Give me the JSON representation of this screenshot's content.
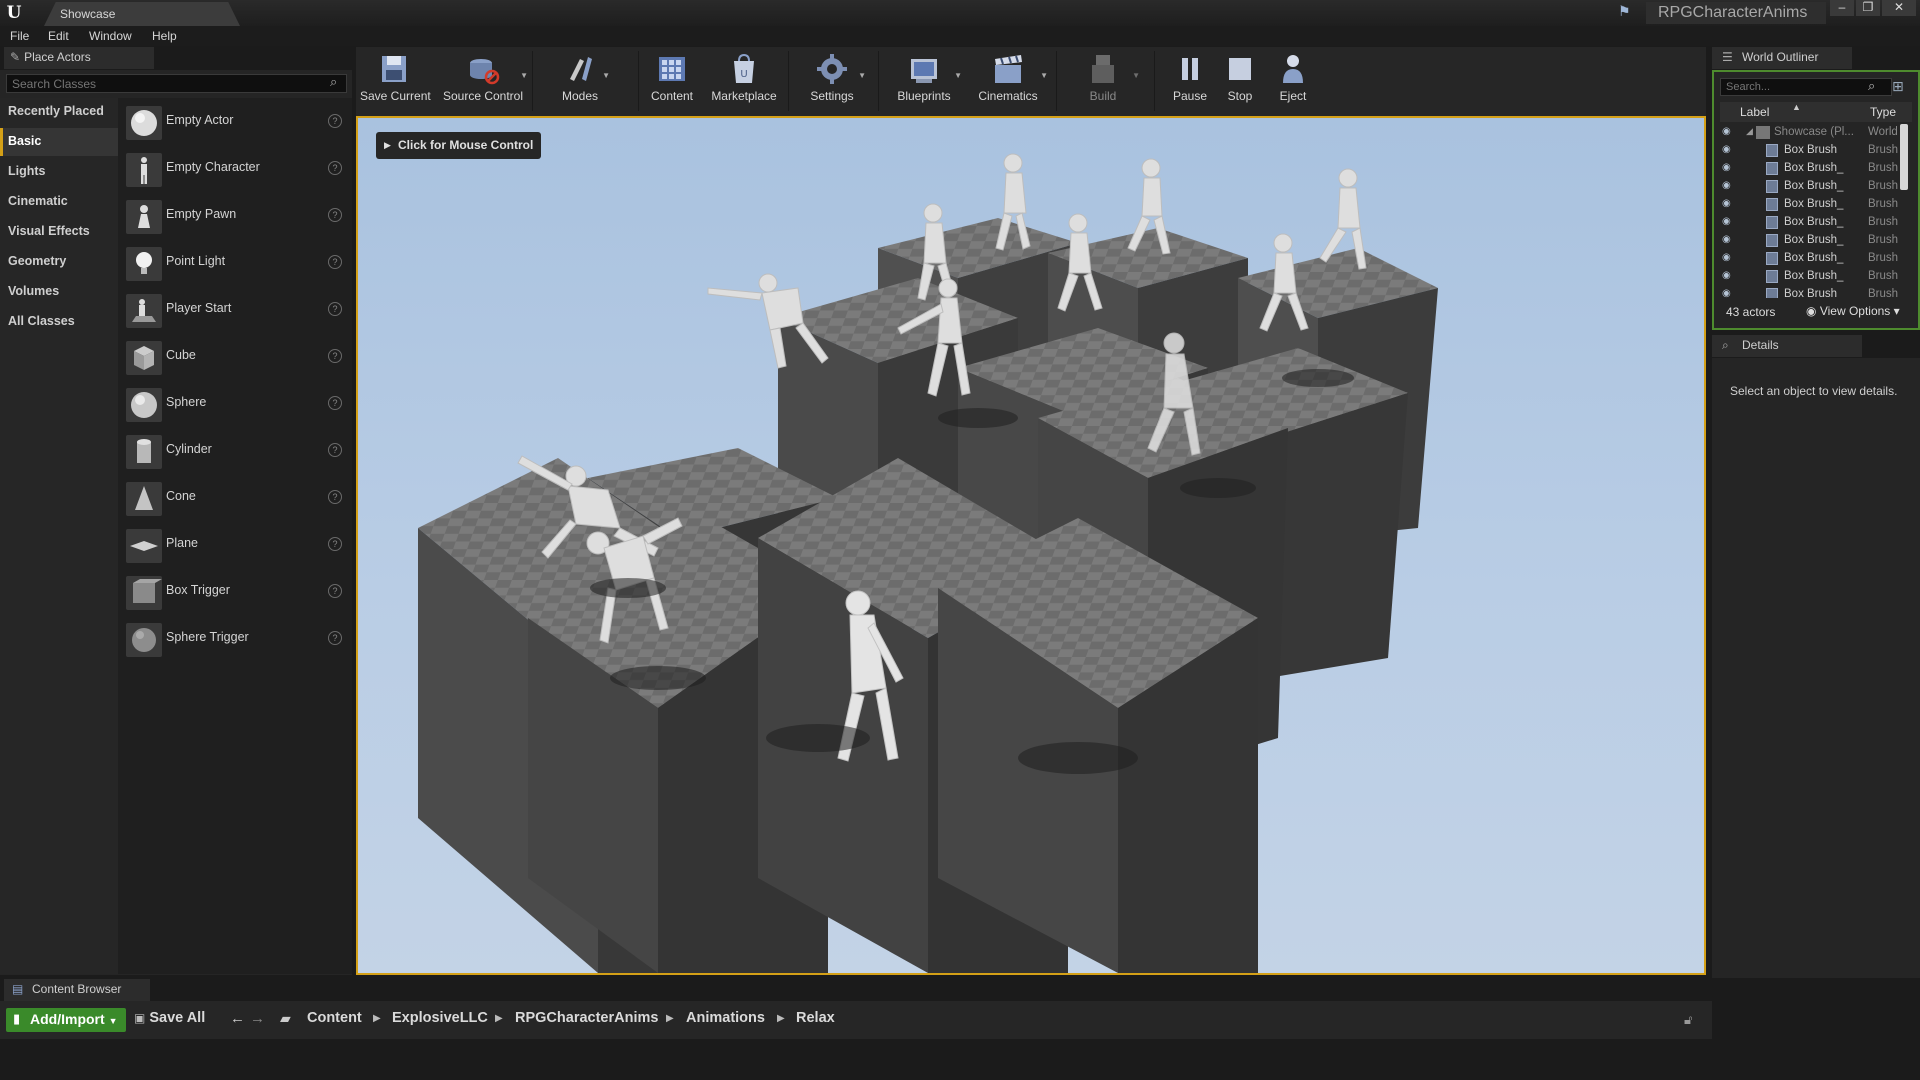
{
  "window": {
    "tab_title": "Showcase",
    "project_name": "RPGCharacterAnims",
    "controls": [
      "minimize",
      "restore",
      "close"
    ]
  },
  "menu": [
    "File",
    "Edit",
    "Window",
    "Help"
  ],
  "place_actors": {
    "tab_label": "Place Actors",
    "search_placeholder": "Search Classes",
    "categories": [
      "Recently Placed",
      "Basic",
      "Lights",
      "Cinematic",
      "Visual Effects",
      "Geometry",
      "Volumes",
      "All Classes"
    ],
    "selected_category": "Basic",
    "items": [
      {
        "label": "Empty Actor",
        "icon": "sphere-icon"
      },
      {
        "label": "Empty Character",
        "icon": "character-icon"
      },
      {
        "label": "Empty Pawn",
        "icon": "pawn-icon"
      },
      {
        "label": "Point Light",
        "icon": "lightbulb-icon"
      },
      {
        "label": "Player Start",
        "icon": "player-start-icon"
      },
      {
        "label": "Cube",
        "icon": "cube-icon"
      },
      {
        "label": "Sphere",
        "icon": "sphere-icon"
      },
      {
        "label": "Cylinder",
        "icon": "cylinder-icon"
      },
      {
        "label": "Cone",
        "icon": "cone-icon"
      },
      {
        "label": "Plane",
        "icon": "plane-icon"
      },
      {
        "label": "Box Trigger",
        "icon": "box-trigger-icon"
      },
      {
        "label": "Sphere Trigger",
        "icon": "sphere-trigger-icon"
      }
    ]
  },
  "toolbar": {
    "save_current": "Save Current",
    "source_control": "Source Control",
    "modes": "Modes",
    "content": "Content",
    "marketplace": "Marketplace",
    "settings": "Settings",
    "blueprints": "Blueprints",
    "cinematics": "Cinematics",
    "build": "Build",
    "pause": "Pause",
    "stop": "Stop",
    "eject": "Eject"
  },
  "viewport": {
    "mouse_control_label": "Click for Mouse Control"
  },
  "world_outliner": {
    "tab_label": "World Outliner",
    "search_placeholder": "Search...",
    "col_label": "Label",
    "col_type": "Type",
    "rows": [
      {
        "label": "Showcase (Pl...",
        "type": "World"
      },
      {
        "label": "Box Brush",
        "type": "Brush"
      },
      {
        "label": "Box Brush_",
        "type": "Brush"
      },
      {
        "label": "Box Brush_",
        "type": "Brush"
      },
      {
        "label": "Box Brush_",
        "type": "Brush"
      },
      {
        "label": "Box Brush_",
        "type": "Brush"
      },
      {
        "label": "Box Brush_",
        "type": "Brush"
      },
      {
        "label": "Box Brush_",
        "type": "Brush"
      },
      {
        "label": "Box Brush_",
        "type": "Brush"
      },
      {
        "label": "Box Brush_",
        "type": "Brush"
      }
    ],
    "actor_count": "43 actors",
    "view_options": "View Options"
  },
  "details": {
    "tab_label": "Details",
    "empty_message": "Select an object to view details."
  },
  "content_browser": {
    "tab_label": "Content Browser",
    "add_import": "Add/Import",
    "save_all": "Save All",
    "breadcrumbs": [
      "Content",
      "ExplosiveLLC",
      "RPGCharacterAnims",
      "Animations",
      "Relax"
    ]
  },
  "colors": {
    "accent_selected_border": "#d4a017",
    "add_import_green": "#3a8a2a",
    "outliner_border_green": "#4e8b2e"
  }
}
